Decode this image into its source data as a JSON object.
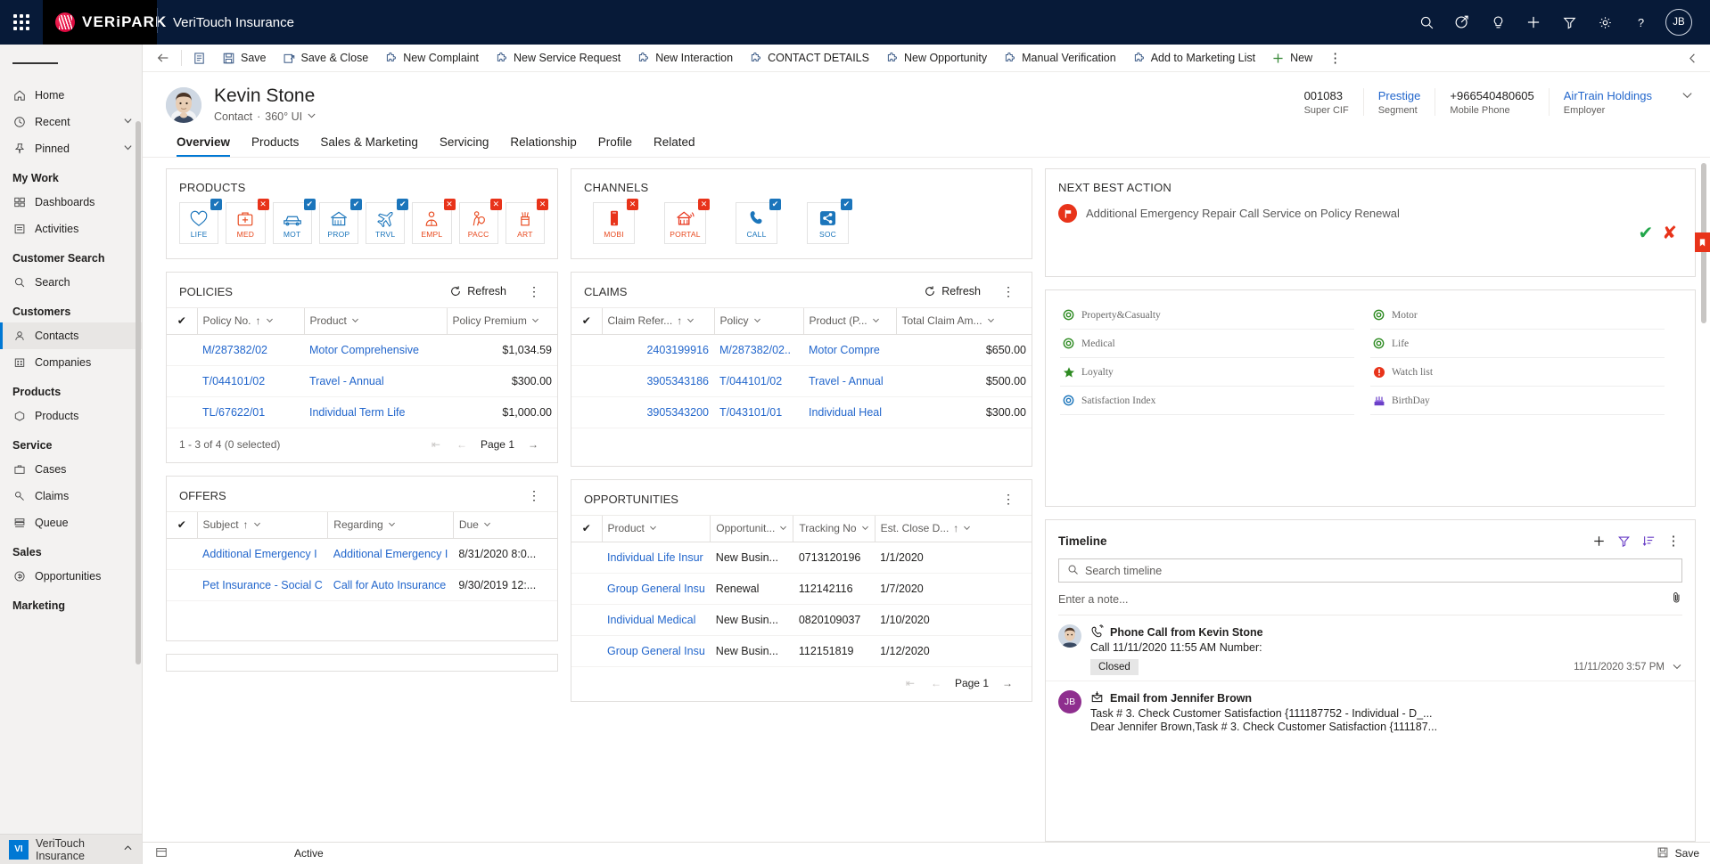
{
  "topnav": {
    "brand": "VERiPARK",
    "app_title": "VeriTouch Insurance",
    "icons": [
      "search-icon",
      "compass-icon",
      "lightbulb-icon",
      "plus-icon",
      "filter-icon",
      "gear-icon",
      "help-icon"
    ],
    "avatar_initials": "JB"
  },
  "sidebar": {
    "groups": [
      {
        "header": null,
        "items": [
          {
            "label": "Home",
            "icon": "home-icon",
            "chevron": false
          },
          {
            "label": "Recent",
            "icon": "clock-icon",
            "chevron": true
          },
          {
            "label": "Pinned",
            "icon": "pin-icon",
            "chevron": true
          }
        ]
      },
      {
        "header": "My Work",
        "items": [
          {
            "label": "Dashboards",
            "icon": "dashboard-icon",
            "chevron": false
          },
          {
            "label": "Activities",
            "icon": "activities-icon",
            "chevron": false
          }
        ]
      },
      {
        "header": "Customer Search",
        "items": [
          {
            "label": "Search",
            "icon": "search-icon",
            "chevron": false
          }
        ]
      },
      {
        "header": "Customers",
        "items": [
          {
            "label": "Contacts",
            "icon": "contact-icon",
            "chevron": false,
            "active": true
          },
          {
            "label": "Companies",
            "icon": "company-icon",
            "chevron": false
          }
        ]
      },
      {
        "header": "Products",
        "items": [
          {
            "label": "Products",
            "icon": "product-icon",
            "chevron": false
          }
        ]
      },
      {
        "header": "Service",
        "items": [
          {
            "label": "Cases",
            "icon": "case-icon",
            "chevron": false
          },
          {
            "label": "Claims",
            "icon": "claim-icon",
            "chevron": false
          },
          {
            "label": "Queue",
            "icon": "queue-icon",
            "chevron": false
          }
        ]
      },
      {
        "header": "Sales",
        "items": [
          {
            "label": "Opportunities",
            "icon": "opportunity-icon",
            "chevron": false
          }
        ]
      },
      {
        "header": "Marketing",
        "items": []
      }
    ],
    "app_switcher": {
      "initials": "VI",
      "label": "VeriTouch Insurance"
    }
  },
  "commandbar": {
    "back": "back-arrow-icon",
    "form_icon": "form-icon",
    "items": [
      {
        "label": "Save",
        "icon": "save-icon"
      },
      {
        "label": "Save & Close",
        "icon": "save-close-icon"
      },
      {
        "label": "New Complaint",
        "icon": "puzzle-icon"
      },
      {
        "label": "New Service Request",
        "icon": "puzzle-icon"
      },
      {
        "label": "New Interaction",
        "icon": "puzzle-icon"
      },
      {
        "label": "CONTACT DETAILS",
        "icon": "puzzle-icon"
      },
      {
        "label": "New Opportunity",
        "icon": "puzzle-icon"
      },
      {
        "label": "Manual Verification",
        "icon": "puzzle-icon"
      },
      {
        "label": "Add to Marketing List",
        "icon": "puzzle-icon"
      },
      {
        "label": "New",
        "icon": "plus-icon"
      }
    ],
    "overflow": "more-commands-icon"
  },
  "record_header": {
    "name": "Kevin Stone",
    "entity": "Contact",
    "form": "360° UI",
    "separator": "·",
    "fields": [
      {
        "value": "001083",
        "label": "Super CIF",
        "link": false
      },
      {
        "value": "Prestige",
        "label": "Segment",
        "link": true
      },
      {
        "value": "+966540480605",
        "label": "Mobile Phone",
        "link": false
      },
      {
        "value": "AirTrain Holdings",
        "label": "Employer",
        "link": true
      }
    ]
  },
  "tabs": [
    {
      "label": "Overview",
      "active": true
    },
    {
      "label": "Products",
      "active": false
    },
    {
      "label": "Sales & Marketing",
      "active": false
    },
    {
      "label": "Servicing",
      "active": false
    },
    {
      "label": "Relationship",
      "active": false
    },
    {
      "label": "Profile",
      "active": false
    },
    {
      "label": "Related",
      "active": false
    }
  ],
  "products_card": {
    "title": "PRODUCTS",
    "tiles": [
      {
        "code": "LIFE",
        "icon": "heart-icon",
        "status": "ok",
        "color": "blue"
      },
      {
        "code": "MED",
        "icon": "medkit-icon",
        "status": "no",
        "color": "red"
      },
      {
        "code": "MOT",
        "icon": "car-icon",
        "status": "ok",
        "color": "blue"
      },
      {
        "code": "PROP",
        "icon": "house-icon",
        "status": "ok",
        "color": "blue"
      },
      {
        "code": "TRVL",
        "icon": "plane-icon",
        "status": "ok",
        "color": "blue"
      },
      {
        "code": "EMPL",
        "icon": "employee-icon",
        "status": "no",
        "color": "red"
      },
      {
        "code": "PACC",
        "icon": "personal-accident-icon",
        "status": "no",
        "color": "red"
      },
      {
        "code": "ART",
        "icon": "art-icon",
        "status": "no",
        "color": "red"
      }
    ]
  },
  "channels_card": {
    "title": "CHANNELS",
    "tiles": [
      {
        "code": "MOBI",
        "icon": "mobile-icon",
        "status": "no",
        "color": "red"
      },
      {
        "code": "PORTAL",
        "icon": "portal-icon",
        "status": "no",
        "color": "red"
      },
      {
        "code": "CALL",
        "icon": "phone-icon",
        "status": "ok",
        "color": "blue"
      },
      {
        "code": "SOC",
        "icon": "share-icon",
        "status": "ok",
        "color": "blue"
      }
    ]
  },
  "policies_card": {
    "title": "POLICIES",
    "refresh_label": "Refresh",
    "columns": [
      "Policy No.",
      "Product",
      "Policy Premium"
    ],
    "rows": [
      {
        "policy_no": "M/287382/02",
        "product": "Motor Comprehensive",
        "premium": "$1,034.59"
      },
      {
        "policy_no": "T/044101/02",
        "product": "Travel - Annual",
        "premium": "$300.00"
      },
      {
        "policy_no": "TL/67622/01",
        "product": "Individual Term Life",
        "premium": "$1,000.00"
      }
    ],
    "count_label": "1 - 3 of 4 (0 selected)",
    "page_label": "Page 1"
  },
  "claims_card": {
    "title": "CLAIMS",
    "refresh_label": "Refresh",
    "columns": [
      "Claim Refer...",
      "Policy",
      "Product (P...",
      "Total Claim Am..."
    ],
    "rows": [
      {
        "ref": "2403199916",
        "policy": "M/287382/02..",
        "product": "Motor Compre",
        "amount": "$650.00"
      },
      {
        "ref": "3905343186",
        "policy": "T/044101/02",
        "product": "Travel - Annual",
        "amount": "$500.00"
      },
      {
        "ref": "3905343200",
        "policy": "T/043101/01",
        "product": "Individual Heal",
        "amount": "$300.00"
      }
    ]
  },
  "offers_card": {
    "title": "OFFERS",
    "columns": [
      "Subject",
      "Regarding",
      "Due"
    ],
    "rows": [
      {
        "subject": "Additional Emergency I",
        "regarding": "Additional Emergency I",
        "due": "8/31/2020 8:0..."
      },
      {
        "subject": "Pet Insurance - Social C",
        "regarding": "Call for Auto Insurance",
        "due": "9/30/2019 12:..."
      }
    ]
  },
  "opportunities_card": {
    "title": "OPPORTUNITIES",
    "columns": [
      "Product",
      "Opportunit...",
      "Tracking No",
      "Est. Close D..."
    ],
    "rows": [
      {
        "product": "Individual Life Insur",
        "type": "New Busin...",
        "tracking": "0713120196",
        "close": "1/1/2020"
      },
      {
        "product": "Group General Insu",
        "type": "Renewal",
        "tracking": "112142116",
        "close": "1/7/2020"
      },
      {
        "product": "Individual Medical",
        "type": "New Busin...",
        "tracking": "0820109037",
        "close": "1/10/2020"
      },
      {
        "product": "Group General Insu",
        "type": "New Busin...",
        "tracking": "112151819",
        "close": "1/12/2020"
      }
    ],
    "page_label": "Page 1"
  },
  "next_best_action": {
    "title": "NEXT BEST ACTION",
    "text": "Additional Emergency Repair Call Service on Policy Renewal",
    "accept_icon": "check-icon",
    "reject_icon": "cross-icon"
  },
  "indicators": {
    "left": [
      {
        "label": "Property&Casualty",
        "icon": "target-icon",
        "color": "#2e8b22"
      },
      {
        "label": "Medical",
        "icon": "target-icon",
        "color": "#2e8b22"
      },
      {
        "label": "Loyalty",
        "icon": "star-icon",
        "color": "#2e8b22"
      },
      {
        "label": "Satisfaction Index",
        "icon": "target-icon",
        "color": "#1b75bb"
      }
    ],
    "right": [
      {
        "label": "Motor",
        "icon": "target-icon",
        "color": "#2e8b22"
      },
      {
        "label": "Life",
        "icon": "target-icon",
        "color": "#2e8b22"
      },
      {
        "label": "Watch list",
        "icon": "alert-icon",
        "color": "#e8331a"
      },
      {
        "label": "BirthDay",
        "icon": "cake-icon",
        "color": "#6a3fc7"
      }
    ]
  },
  "timeline": {
    "title": "Timeline",
    "icons": [
      "add-icon",
      "filter-icon",
      "sort-icon",
      "more-icon"
    ],
    "search_placeholder": "Search timeline",
    "note_placeholder": "Enter a note...",
    "attach_icon": "paperclip-icon",
    "items": [
      {
        "avatar_type": "photo",
        "initials": "",
        "icon": "phone-call-icon",
        "title": "Phone Call from Kevin Stone",
        "lines": [
          "Call 11/11/2020 11:55 AM",
          "Number:"
        ],
        "status": "Closed",
        "time": "11/11/2020 3:57 PM"
      },
      {
        "avatar_type": "initials",
        "initials": "JB",
        "icon": "email-icon",
        "title": "Email from Jennifer Brown",
        "lines": [
          "Task # 3. Check Customer Satisfaction {111187752 - Individual - D_...",
          "Dear Jennifer Brown,Task # 3. Check Customer Satisfaction {111187..."
        ],
        "status": "",
        "time": ""
      }
    ]
  },
  "footer": {
    "form_icon": "form-select-icon",
    "status": "Active",
    "save_label": "Save",
    "save_icon": "save-disk-icon"
  },
  "colors": {
    "nav_bg": "#071A38",
    "accent": "#0078d4",
    "link": "#2266cc",
    "brand_red": "#e00b41",
    "status_ok": "#1b75bb",
    "status_no": "#e8331a",
    "green": "#21a64a"
  }
}
